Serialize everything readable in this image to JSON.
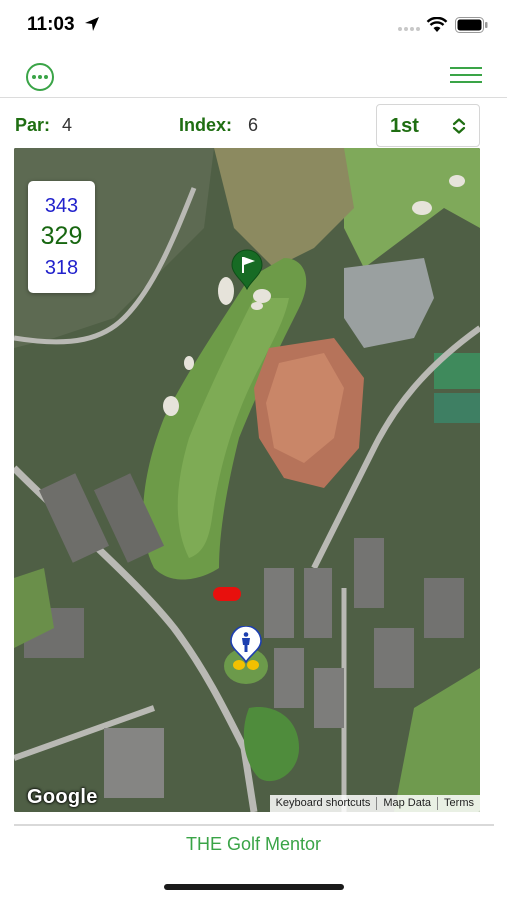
{
  "status_bar": {
    "time": "11:03",
    "icons": [
      "location-arrow-icon",
      "signal-icon",
      "wifi-icon",
      "battery-icon"
    ]
  },
  "nav": {
    "left_icon": "more-options-icon",
    "right_icon": "hamburger-menu-icon",
    "accent_color": "#3aa447"
  },
  "hole_info": {
    "par_label": "Par:",
    "par_value": "4",
    "index_label": "Index:",
    "index_value": "6",
    "hole_selected": "1st",
    "label_color": "#1f6e12"
  },
  "distances": {
    "back": "343",
    "middle": "329",
    "front": "318"
  },
  "map": {
    "markers": [
      "green-flag-pin-icon",
      "target-marker",
      "player-location-pin-icon"
    ],
    "provider": "Google",
    "attribution": [
      "Keyboard shortcuts",
      "Map Data",
      "Terms"
    ]
  },
  "footer": {
    "brand": "THE Golf Mentor"
  }
}
